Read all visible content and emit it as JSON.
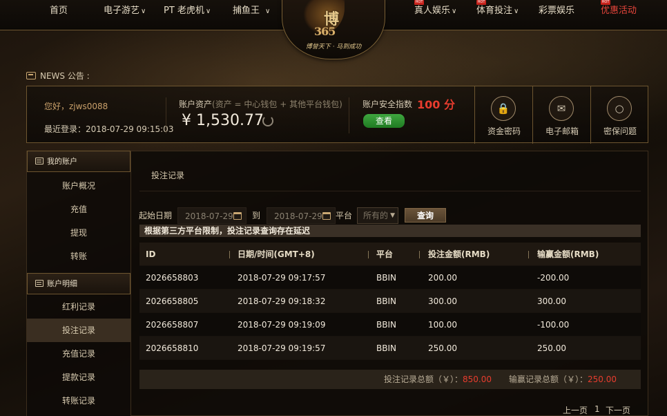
{
  "nav": {
    "items": [
      {
        "label": "首页",
        "dropdown": false,
        "hot": false
      },
      {
        "label": "电子游艺",
        "dropdown": true,
        "hot": false
      },
      {
        "label": "PT 老虎机",
        "dropdown": true,
        "hot": false
      },
      {
        "label": "捕鱼王",
        "dropdown": true,
        "hot": false
      },
      {
        "label": "真人娱乐",
        "dropdown": true,
        "hot": true
      },
      {
        "label": "体育投注",
        "dropdown": true,
        "hot": true
      },
      {
        "label": "彩票娱乐",
        "dropdown": false,
        "hot": false
      },
      {
        "label": "优惠活动",
        "dropdown": false,
        "hot": true
      }
    ],
    "hot_badge": "HOT"
  },
  "logo": {
    "text": "博",
    "number": "365",
    "slogan": "博誉天下 · 马到成功"
  },
  "news": {
    "label": "NEWS 公告 :"
  },
  "account": {
    "greeting": "您好，zjws0088",
    "last_login": "最近登录：2018-07-29 09:15:03",
    "asset_label": "账户资产",
    "asset_note": "(资产 = 中心钱包 + 其他平台钱包)",
    "balance": "¥ 1,530.77",
    "security_label": "账户安全指数",
    "security_score": "100 分",
    "view_button": "查看",
    "tiles": [
      {
        "icon": "lock-icon",
        "label": "资金密码"
      },
      {
        "icon": "mail-icon",
        "label": "电子邮箱"
      },
      {
        "icon": "lightbulb-icon",
        "label": "密保问题"
      }
    ]
  },
  "sidebar": {
    "section1_title": "我的账户",
    "section1_items": [
      "账户概况",
      "充值",
      "提现",
      "转账"
    ],
    "section2_title": "账户明细",
    "section2_items": [
      "红利记录",
      "投注记录",
      "充值记录",
      "提款记录",
      "转账记录"
    ],
    "active_item": "投注记录"
  },
  "main": {
    "title": "投注记录",
    "filter": {
      "start_label": "起始日期",
      "start_date": "2018-07-29",
      "to_label": "到",
      "end_date": "2018-07-29",
      "platform_label": "平台",
      "platform_value": "所有的",
      "query_button": "查询"
    },
    "notice": "根据第三方平台限制，投注记录查询存在延迟",
    "table": {
      "headers": [
        "ID",
        "日期/时间(GMT+8)",
        "平台",
        "投注金额(RMB)",
        "输赢金额(RMB)"
      ],
      "rows": [
        [
          "2026658803",
          "2018-07-29 09:17:57",
          "BBIN",
          "200.00",
          "-200.00"
        ],
        [
          "2026658805",
          "2018-07-29 09:18:32",
          "BBIN",
          "300.00",
          "300.00"
        ],
        [
          "2026658807",
          "2018-07-29 09:19:09",
          "BBIN",
          "100.00",
          "-100.00"
        ],
        [
          "2026658810",
          "2018-07-29 09:19:57",
          "BBIN",
          "250.00",
          "250.00"
        ]
      ]
    },
    "summary": {
      "bet_label": "投注记录总额（￥）：",
      "bet_total": "850.00",
      "win_label": "输赢记录总额（￥）：",
      "win_total": "250.00"
    },
    "pager": {
      "prev": "上一页",
      "page": "1",
      "next": "下一页"
    }
  }
}
